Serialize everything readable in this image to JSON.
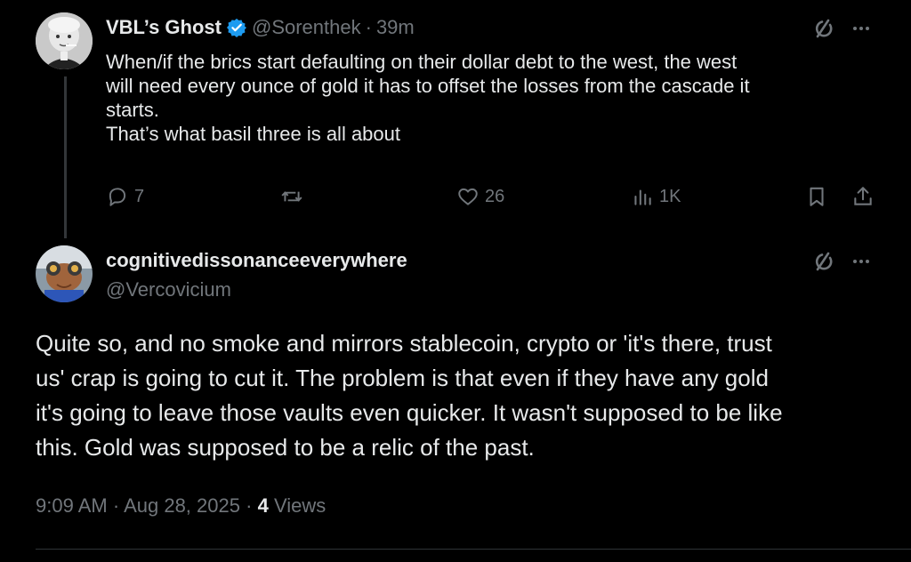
{
  "tweet1": {
    "display_name": "VBL’s Ghost",
    "handle": "@Sorenthek",
    "separator": "·",
    "time": "39m",
    "text_lines": [
      "When/if the brics start defaulting on their dollar debt to the west, the west",
      "will need every ounce of gold it has to offset the losses from the cascade it",
      "starts.",
      "That’s what basil three is all about"
    ],
    "actions": {
      "replies": "7",
      "reposts": "",
      "likes": "26",
      "views": "1K"
    }
  },
  "tweet2": {
    "display_name": "cognitivedissonanceeverywhere",
    "handle": "@Vercovicium",
    "text_lines": [
      "Quite so, and no smoke and mirrors stablecoin, crypto or 'it's there, trust",
      "us' crap is going to cut it. The problem is that even if they have any gold",
      "it's going to leave those vaults even quicker. It wasn't supposed to be like",
      "this. Gold was supposed to be a relic of the past."
    ],
    "meta": {
      "time": "9:09 AM",
      "sep1": "·",
      "date": "Aug 28, 2025",
      "sep2": "·",
      "views_count": "4",
      "views_label": "Views"
    }
  },
  "colors": {
    "background": "#000000",
    "text": "#e7e9ea",
    "muted": "#71767b",
    "verified": "#1d9bf0"
  }
}
